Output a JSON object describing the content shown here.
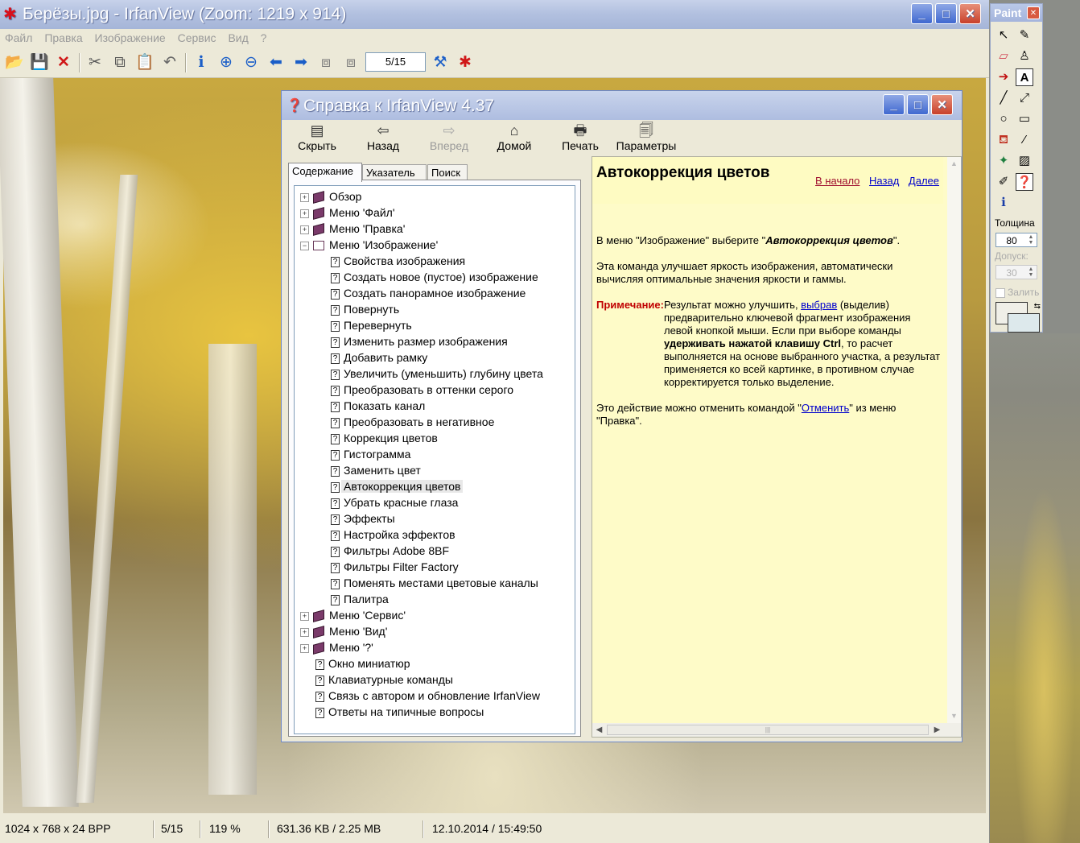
{
  "irfanview": {
    "title": "Берёзы.jpg - IrfanView (Zoom: 1219 x 914)",
    "menu": [
      "Файл",
      "Правка",
      "Изображение",
      "Сервис",
      "Вид",
      "?"
    ],
    "page_box": "5/15",
    "status": {
      "dimensions": "1024 x 768 x 24 BPP",
      "page": "5/15",
      "zoom": "119 %",
      "size": "631.36 KB / 2.25 MB",
      "datetime": "12.10.2014 / 15:49:50"
    }
  },
  "help": {
    "title": "Справка к IrfanView 4.37",
    "toolbar": {
      "hide": "Скрыть",
      "back": "Назад",
      "forward": "Вперед",
      "home": "Домой",
      "print": "Печать",
      "options": "Параметры"
    },
    "tabs": {
      "contents": "Содержание",
      "index": "Указатель",
      "search": "Поиск"
    },
    "tree": [
      "Обзор",
      "Меню 'Файл'",
      "Меню 'Правка'",
      "Меню 'Изображение'",
      "Свойства изображения",
      "Создать новое (пустое) изображение",
      "Создать панорамное изображение",
      "Повернуть",
      "Перевернуть",
      "Изменить размер изображения",
      "Добавить рамку",
      "Увеличить (уменьшить) глубину цвета",
      "Преобразовать в оттенки серого",
      "Показать канал",
      "Преобразовать в негативное",
      "Коррекция цветов",
      "Гистограмма",
      "Заменить цвет",
      "Автокоррекция цветов",
      "Убрать красные глаза",
      "Эффекты",
      "Настройка эффектов",
      "Фильтры Adobe 8BF",
      "Фильтры Filter Factory",
      "Поменять местами цветовые каналы",
      "Палитра",
      "Меню 'Сервис'",
      "Меню 'Вид'",
      "Меню '?'",
      "Окно миниатюр",
      "Клавиатурные команды",
      "Связь с автором и обновление IrfanView",
      "Ответы на типичные вопросы"
    ],
    "topic": {
      "title": "Автокоррекция цветов",
      "nav_home": "В начало",
      "nav_back": "Назад",
      "nav_next": "Далее",
      "p1_a": "В меню \"Изображение\" выберите \"",
      "p1_b": "Автокоррекция цветов",
      "p1_c": "\".",
      "p2": "Эта команда улучшает яркость изображения, автоматически вычисляя оптимальные значения яркости и гаммы.",
      "note_label": "Примечание:",
      "note_a": "Результат можно улучшить, ",
      "note_link": "выбрав",
      "note_b": " (выделив) предварительно ключевой фрагмент изображения левой кнопкой мыши. Если при выборе команды ",
      "note_bold": "удерживать нажатой клавишу Ctrl",
      "note_c": ", то расчет выполняется на основе выбранного участка, а результат применяется ко всей картинке, в противном случае корректируется только выделение.",
      "p3_a": "Это действие можно отменить командой \"",
      "p3_link": "Отменить",
      "p3_b": "\" из меню \"Правка\"."
    }
  },
  "paint": {
    "title": "Paint",
    "thickness_label": "Толщина",
    "thickness_value": "80",
    "tolerance_label": "Допуск:",
    "tolerance_value": "30",
    "fill_label": "Залить"
  }
}
